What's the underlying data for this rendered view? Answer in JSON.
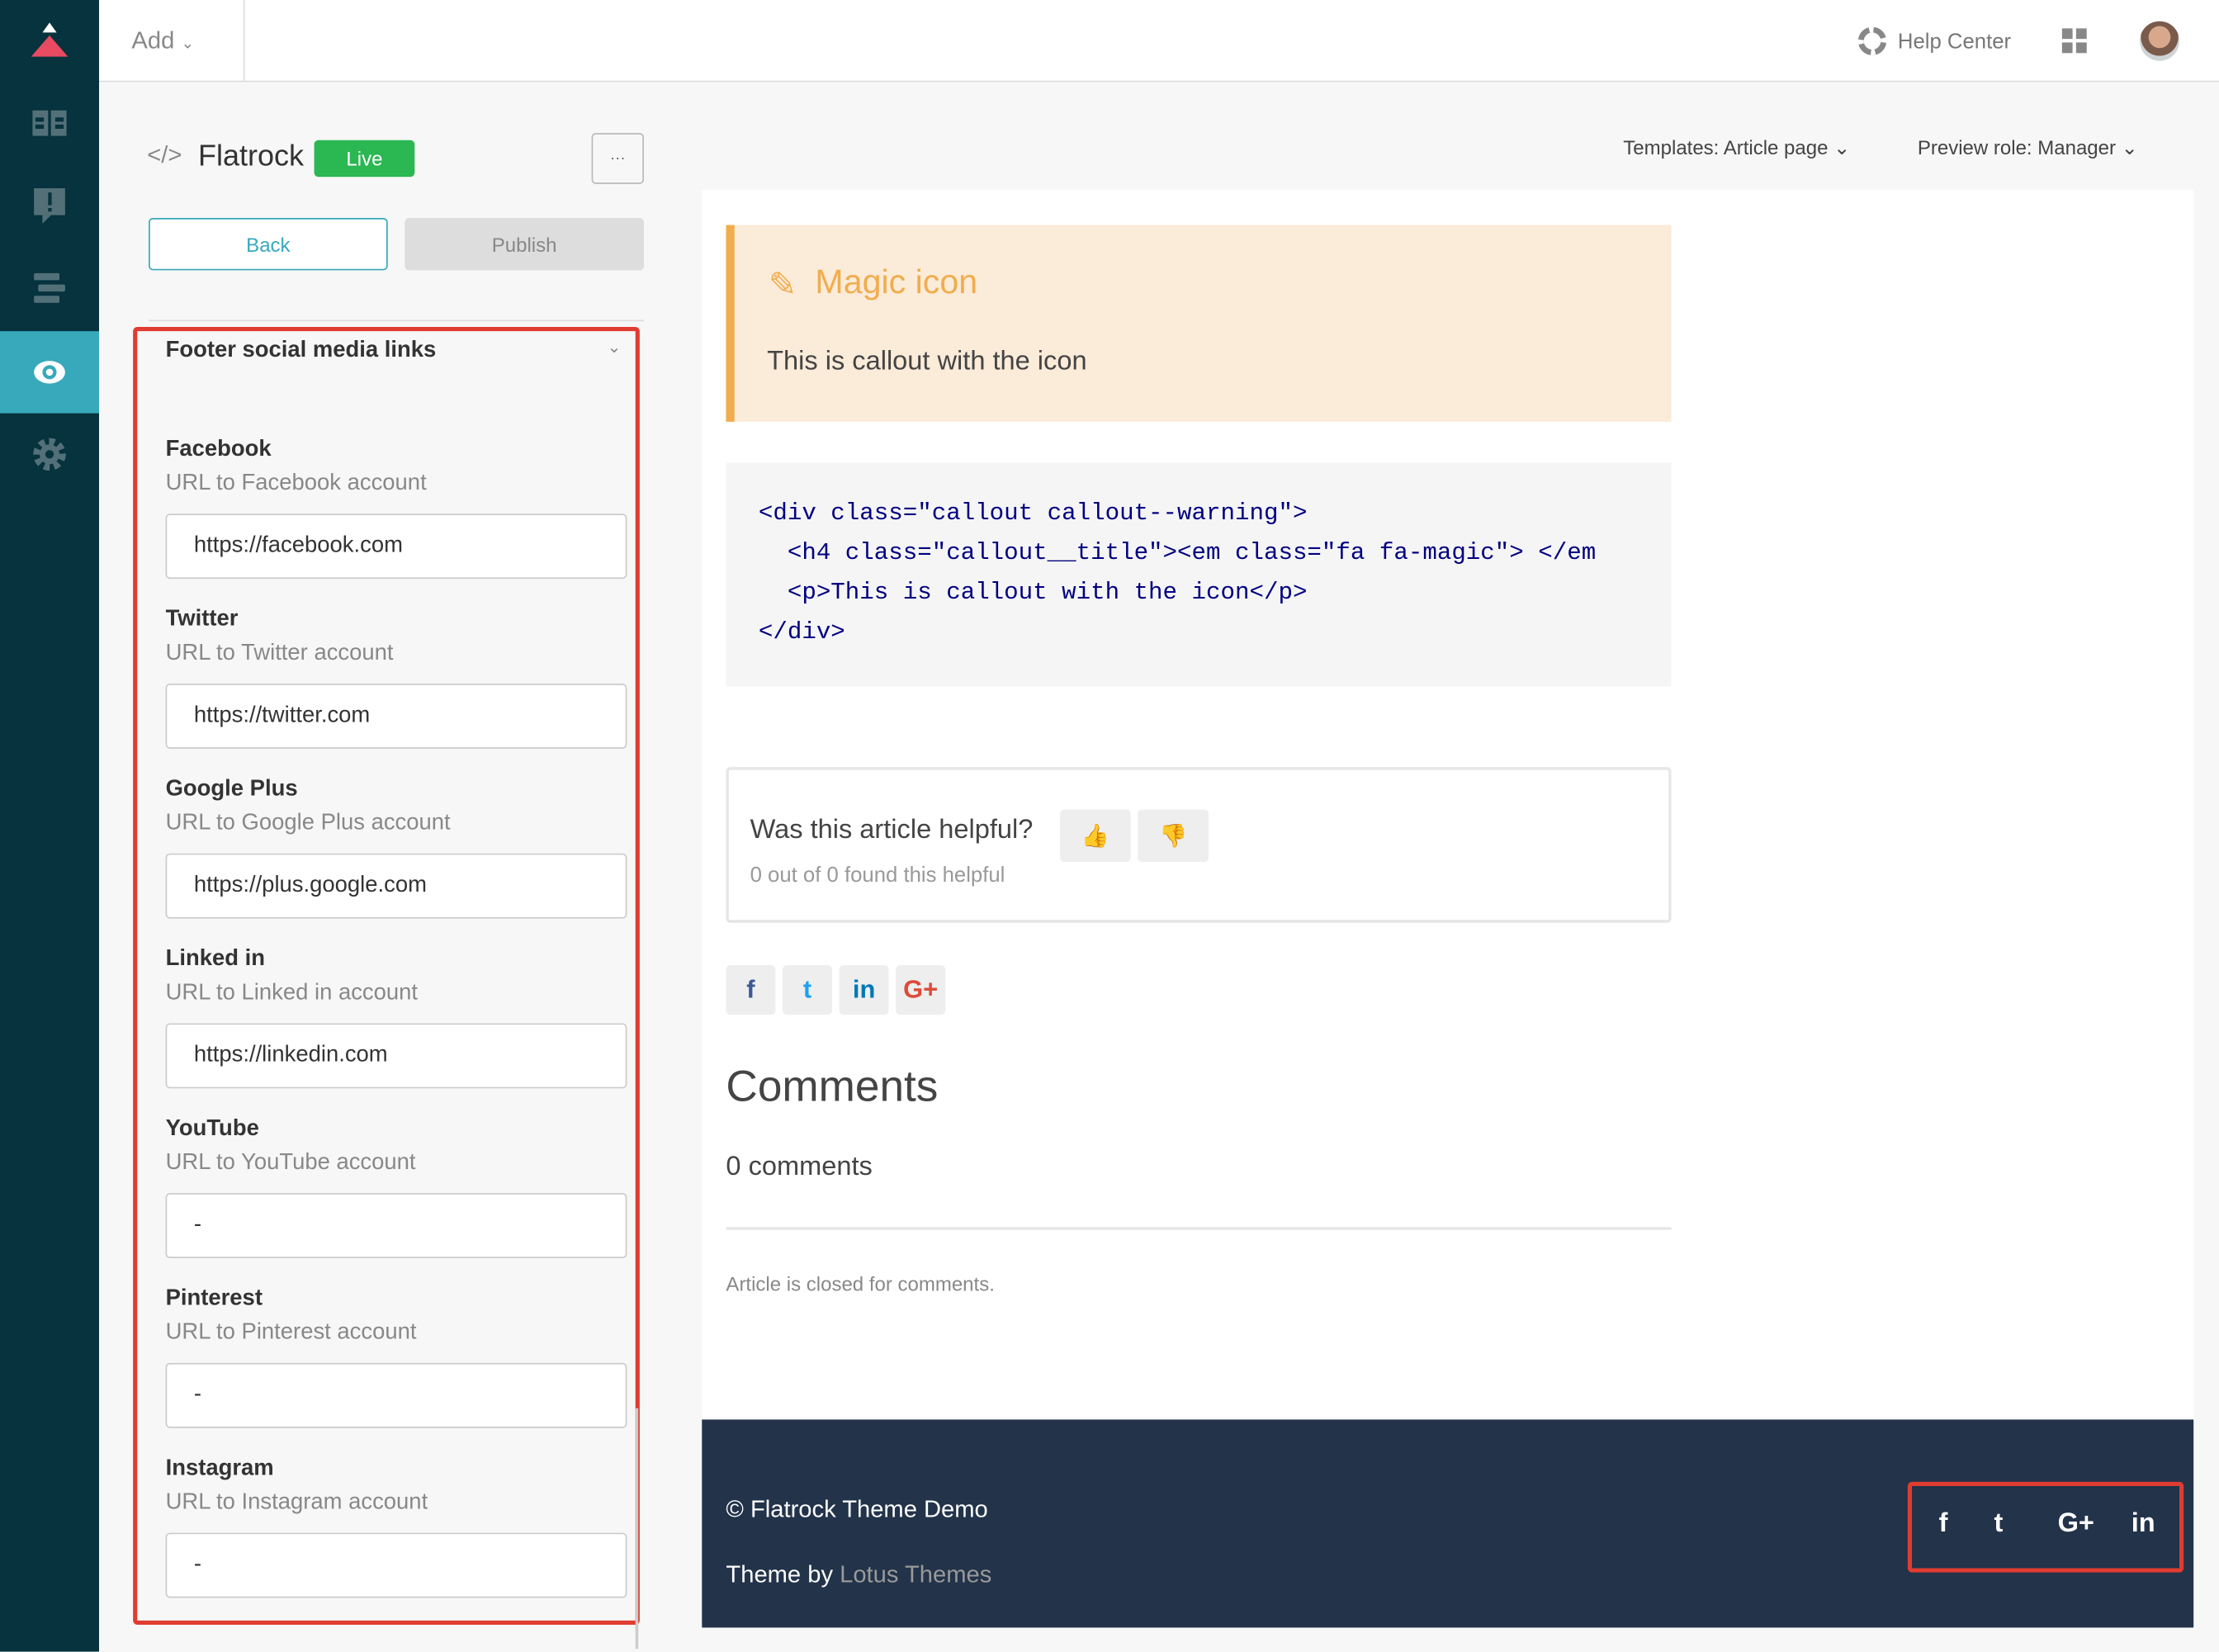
{
  "topbar": {
    "add_label": "Add",
    "help_center": "Help Center"
  },
  "sidebar": {
    "items": [
      {
        "icon": "logo-icon"
      },
      {
        "icon": "guide-book-icon"
      },
      {
        "icon": "feedback-icon"
      },
      {
        "icon": "arrange-icon"
      },
      {
        "icon": "eye-icon",
        "active": true
      },
      {
        "icon": "gear-icon"
      }
    ]
  },
  "theme": {
    "name": "Flatrock",
    "status": "Live",
    "more": "···",
    "back": "Back",
    "publish": "Publish"
  },
  "panel": {
    "section_title": "Footer social media links",
    "fields": [
      {
        "label": "Facebook",
        "desc": "URL to Facebook account",
        "value": "https://facebook.com"
      },
      {
        "label": "Twitter",
        "desc": "URL to Twitter account",
        "value": "https://twitter.com"
      },
      {
        "label": "Google Plus",
        "desc": "URL to Google Plus account",
        "value": "https://plus.google.com"
      },
      {
        "label": "Linked in",
        "desc": "URL to Linked in account",
        "value": "https://linkedin.com"
      },
      {
        "label": "YouTube",
        "desc": "URL to YouTube account",
        "value": "-"
      },
      {
        "label": "Pinterest",
        "desc": "URL to Pinterest account",
        "value": "-"
      },
      {
        "label": "Instagram",
        "desc": "URL to Instagram account",
        "value": "-"
      }
    ]
  },
  "preview": {
    "templates": "Templates: Article page",
    "role": "Preview role: Manager"
  },
  "article": {
    "callout_title": "Magic icon",
    "callout_body": "This is callout with the icon",
    "code": [
      "<div class=\"callout callout--warning\">",
      "  <h4 class=\"callout__title\"><em class=\"fa fa-magic\"> </em",
      "  <p>This is callout with the icon</p>",
      "</div>"
    ],
    "helpful_q": "Was this article helpful?",
    "helpful_count": "0 out of 0 found this helpful",
    "share": [
      "f",
      "t",
      "in",
      "G+"
    ],
    "comments_title": "Comments",
    "comments_count": "0 comments",
    "closed": "Article is closed for comments."
  },
  "footer": {
    "copyright": "© Flatrock Theme Demo",
    "theme_by": "Theme by",
    "theme_link": "Lotus Themes",
    "social": [
      "f",
      "t",
      "G+",
      "in"
    ]
  },
  "colors": {
    "sidebar": "#06333d",
    "accent": "#37a9bb",
    "live": "#2bb752",
    "callout_border": "#f0ad4e",
    "callout_bg": "#fbebd9",
    "footer": "#22334a",
    "highlight": "#e03c31"
  }
}
